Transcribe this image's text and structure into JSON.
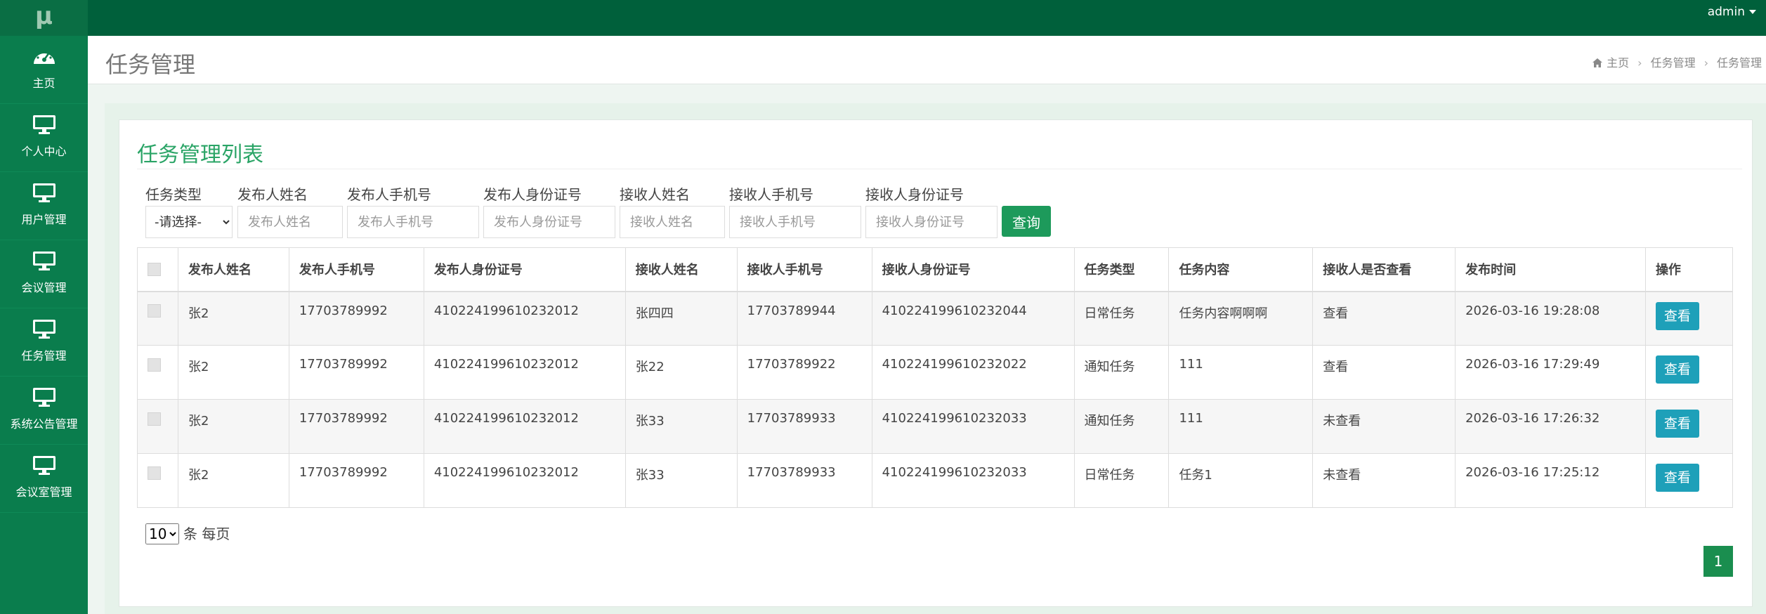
{
  "app": {
    "logo_text": "μ"
  },
  "topbar": {
    "user_label": "admin"
  },
  "sidebar": {
    "items": [
      {
        "label": "主页",
        "icon": "dashboard-icon"
      },
      {
        "label": "个人中心",
        "icon": "monitor-icon"
      },
      {
        "label": "用户管理",
        "icon": "monitor-icon"
      },
      {
        "label": "会议管理",
        "icon": "monitor-icon"
      },
      {
        "label": "任务管理",
        "icon": "monitor-icon"
      },
      {
        "label": "系统公告管理",
        "icon": "monitor-icon"
      },
      {
        "label": "会议室管理",
        "icon": "monitor-icon"
      }
    ]
  },
  "header": {
    "title": "任务管理",
    "breadcrumb": [
      "主页",
      "任务管理",
      "任务管理"
    ]
  },
  "card": {
    "title": "任务管理列表"
  },
  "search": {
    "task_type": {
      "label": "任务类型",
      "selected": "-请选择-"
    },
    "publisher_name": {
      "label": "发布人姓名",
      "placeholder": "发布人姓名"
    },
    "publisher_phone": {
      "label": "发布人手机号",
      "placeholder": "发布人手机号"
    },
    "publisher_id": {
      "label": "发布人身份证号",
      "placeholder": "发布人身份证号"
    },
    "receiver_name": {
      "label": "接收人姓名",
      "placeholder": "接收人姓名"
    },
    "receiver_phone": {
      "label": "接收人手机号",
      "placeholder": "接收人手机号"
    },
    "receiver_id": {
      "label": "接收人身份证号",
      "placeholder": "接收人身份证号"
    },
    "query_label": "查询"
  },
  "table": {
    "headers": [
      "发布人姓名",
      "发布人手机号",
      "发布人身份证号",
      "接收人姓名",
      "接收人手机号",
      "接收人身份证号",
      "任务类型",
      "任务内容",
      "接收人是否查看",
      "发布时间",
      "操作"
    ],
    "view_label": "查看",
    "rows": [
      [
        "张2",
        "17703789992",
        "410224199610232012",
        "张四四",
        "17703789944",
        "410224199610232044",
        "日常任务",
        "任务内容啊啊啊",
        "查看",
        "2026-03-16 19:28:08"
      ],
      [
        "张2",
        "17703789992",
        "410224199610232012",
        "张22",
        "17703789922",
        "410224199610232022",
        "通知任务",
        "111",
        "查看",
        "2026-03-16 17:29:49"
      ],
      [
        "张2",
        "17703789992",
        "410224199610232012",
        "张33",
        "17703789933",
        "410224199610232033",
        "通知任务",
        "111",
        "未查看",
        "2026-03-16 17:26:32"
      ],
      [
        "张2",
        "17703789992",
        "410224199610232012",
        "张33",
        "17703789933",
        "410224199610232033",
        "日常任务",
        "任务1",
        "未查看",
        "2026-03-16 17:25:12"
      ]
    ]
  },
  "footer": {
    "page_size": "10",
    "page_size_suffix": "条 每页",
    "current_page": "1"
  }
}
